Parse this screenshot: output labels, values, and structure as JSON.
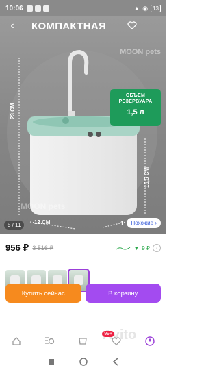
{
  "status_bar": {
    "time": "10:06",
    "battery": "13"
  },
  "hero": {
    "title": "КОМПАКТНАЯ",
    "brand_top": "MOON pets",
    "brand_bottom": "MOON pets",
    "volume_badge": {
      "line1": "ОБЪЕМ",
      "line2": "РЕЗЕРВУАРА",
      "value": "1,5 л"
    },
    "dimensions": {
      "height": "23 СМ",
      "height_inner": "15,5 СМ",
      "width": "12 СМ",
      "depth": "1"
    },
    "page_counter": "5 / 11",
    "similar_button": "Похожие ›"
  },
  "product": {
    "price": "956 ₽",
    "old_price": "3 516 ₽",
    "bonus_value": "9 ₽"
  },
  "thumbnails": [
    {
      "icon": "thumbnail"
    },
    {
      "icon": "thumbnail"
    },
    {
      "icon": "thumbnail"
    },
    {
      "icon": "thumbnail",
      "selected": true
    }
  ],
  "actions": {
    "buy_now": "Купить сейчас",
    "add_to_cart": "В корзину"
  },
  "bottom_nav": {
    "cart_badge": "99+",
    "items": [
      "home-icon",
      "search-icon",
      "cart-icon",
      "favorites-icon",
      "profile-icon"
    ],
    "accent_color": "#9b3fd9"
  },
  "watermark": "Avito",
  "colors": {
    "buy_button": "#f68a1e",
    "cart_button": "#a34bf0",
    "volume_badge": "#1e9b5a"
  }
}
